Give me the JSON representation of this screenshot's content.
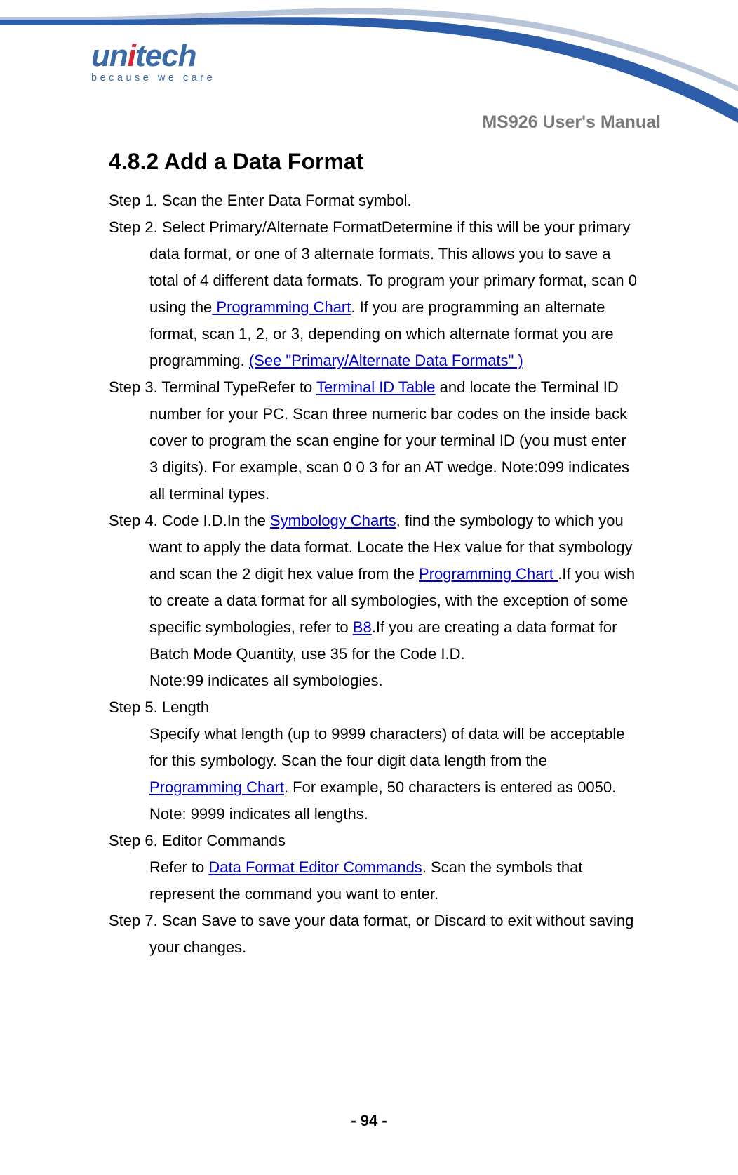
{
  "header": {
    "logo_main": "unitech",
    "tagline": "because we care",
    "manual_title": "MS926 User's Manual"
  },
  "section": {
    "heading": "4.8.2 Add a Data Format",
    "step1": "Step 1. Scan the Enter Data Format symbol.",
    "step2_lead": "Step 2. Select Primary/Alternate FormatDetermine if this will be your primary",
    "step2_b1": "data format, or one of 3 alternate formats. This allows you to save a",
    "step2_b2": "total of 4 different data formats. To program your primary format, scan 0",
    "step2_b3a": "using the",
    "step2_link_prog": " Programming Chart",
    "step2_b3b": ". If you are programming an alternate",
    "step2_b4": "format, scan 1, 2, or 3, depending on which alternate format you are",
    "step2_b5a": "programming. ",
    "step2_link_primary": "(See \"Primary/Alternate Data Formats\" )",
    "step3_lead_a": "Step 3. Terminal TypeRefer to ",
    "step3_link_term": "Terminal ID Table",
    "step3_lead_b": " and locate the Terminal ID",
    "step3_b1": "number for your PC. Scan three numeric bar codes on the inside back",
    "step3_b2": "cover to program the scan engine for your terminal ID (you must enter",
    "step3_b3": "3 digits). For example, scan 0 0 3 for an AT wedge. Note:099 indicates",
    "step3_b4": "all terminal types.",
    "step4_lead_a": "Step 4. Code I.D.In the ",
    "step4_link_sym": "Symbology Charts",
    "step4_lead_b": ", find the symbology to which you",
    "step4_b1": "want to apply the data format. Locate the Hex value for that symbology",
    "step4_b2a": "and scan the 2 digit hex value from the ",
    "step4_link_prog": "Programming Chart ",
    "step4_b2b": ".If you wish",
    "step4_b3": "to create a data format for all symbologies, with the exception of some",
    "step4_b4a": "specific symbologies, refer to ",
    "step4_link_b8": "B8",
    "step4_b4b": ".If you are creating a data format for",
    "step4_b5": "Batch Mode Quantity, use 35 for the Code I.D.",
    "step4_b6": "Note:99 indicates all symbologies.",
    "step5_lead": "Step 5. Length",
    "step5_b1": "Specify what length (up to 9999 characters) of data will be acceptable",
    "step5_b2": "for this symbology. Scan the four digit data length from the",
    "step5_link_prog": "Programming Chart",
    "step5_b3b": ". For example, 50 characters is entered as 0050.",
    "step5_b4": "Note: 9999 indicates all lengths.",
    "step6_lead": "Step 6. Editor Commands",
    "step6_b1a": "Refer to ",
    "step6_link_dfe": "Data Format Editor Commands",
    "step6_b1b": ". Scan the symbols that",
    "step6_b2": "represent the command you want to enter.",
    "step7_lead": "Step 7. Scan Save to save your data format, or Discard to exit without saving",
    "step7_b1": "your changes."
  },
  "footer": {
    "page_number": "- 94 -"
  }
}
